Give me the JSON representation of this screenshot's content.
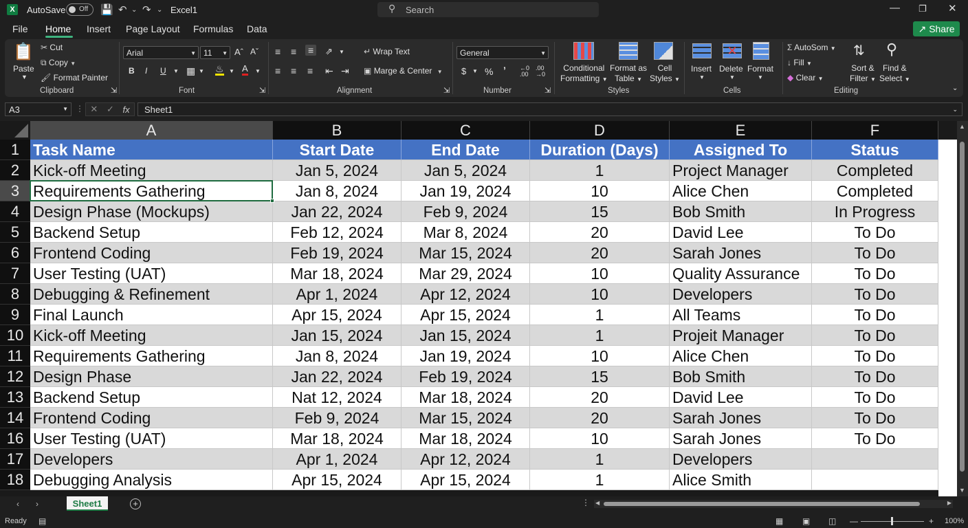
{
  "titlebar": {
    "autosave_label": "AutoSave",
    "autosave_state": "Off",
    "doc_title": "Excel1",
    "search_placeholder": "Search"
  },
  "menu": {
    "tabs": [
      "File",
      "Home",
      "Insert",
      "Page Layout",
      "Formulas",
      "Data"
    ],
    "share_label": "Share"
  },
  "ribbon": {
    "clipboard": {
      "paste": "Paste",
      "cut": "Cut",
      "copy": "Copy",
      "format_painter": "Format Painter",
      "label": "Clipboard"
    },
    "font": {
      "name": "Arial",
      "size": "11",
      "label": "Font"
    },
    "alignment": {
      "wrap_text": "Wrap Text",
      "merge_center": "Marge & Center",
      "label": "Alignment"
    },
    "number": {
      "format": "General",
      "label": "Number"
    },
    "styles": {
      "conditional_1": "Conditional",
      "conditional_2": "Formatting",
      "format_table_1": "Format as",
      "format_table_2": "Table",
      "cell_styles_1": "Cell",
      "cell_styles_2": "Styles",
      "label": "Styles"
    },
    "cells": {
      "insert": "Insert",
      "delete": "Delete",
      "format": "Format",
      "label": "Cells"
    },
    "editing": {
      "autosum": "AutoSom",
      "fill": "Fill",
      "clear": "Clear",
      "sort_1": "Sort &",
      "sort_2": "Filter",
      "find_1": "Find &",
      "find_2": "Select",
      "label": "Editing"
    }
  },
  "formula_bar": {
    "name_box": "A3",
    "formula": "Sheet1"
  },
  "sheet": {
    "columns": [
      "A",
      "B",
      "C",
      "D",
      "E",
      "F"
    ],
    "selected_column": "A",
    "selected_row": "3",
    "header_row_num": "1",
    "headers": [
      "Task Name",
      "Start Date",
      "End Date",
      "Duration (Days)",
      "Assigned To",
      "Status"
    ],
    "rows": [
      {
        "num": "2",
        "cells": [
          "Kick-off Meeting",
          "Jan 5, 2024",
          "Jan 5, 2024",
          "1",
          "Project Manager",
          "Completed"
        ]
      },
      {
        "num": "3",
        "cells": [
          "Requirements Gathering",
          "Jan 8, 2024",
          "Jan 19, 2024",
          "10",
          "Alice Chen",
          "Completed"
        ]
      },
      {
        "num": "4",
        "cells": [
          "Design Phase (Mockups)",
          "Jan 22, 2024",
          "Feb 9, 2024",
          "15",
          "Bob Smith",
          "In Progress"
        ]
      },
      {
        "num": "5",
        "cells": [
          "Backend Setup",
          "Feb 12, 2024",
          "Mar 8, 2024",
          "20",
          "David Lee",
          "To Do"
        ]
      },
      {
        "num": "6",
        "cells": [
          "Frontend Coding",
          "Feb 19, 2024",
          "Mar 15, 2024",
          "20",
          "Sarah Jones",
          "To Do"
        ]
      },
      {
        "num": "7",
        "cells": [
          "User Testing (UAT)",
          "Mar 18, 2024",
          "Mar 29, 2024",
          "10",
          "Quality Assurance",
          "To Do"
        ]
      },
      {
        "num": "8",
        "cells": [
          "Debugging & Refinement",
          "Apr 1, 2024",
          "Apr 12, 2024",
          "10",
          "Developers",
          "To Do"
        ]
      },
      {
        "num": "9",
        "cells": [
          "Final Launch",
          "Apr 15, 2024",
          "Apr 15, 2024",
          "1",
          "All Teams",
          "To Do"
        ]
      },
      {
        "num": "10",
        "cells": [
          "Kick-off Meeting",
          "Jan 15, 2024",
          "Jan 15, 2024",
          "1",
          "Projeit Manager",
          "To Do"
        ]
      },
      {
        "num": "11",
        "cells": [
          "Requirements Gathering",
          "Jan 8, 2024",
          "Jan 19, 2024",
          "10",
          "Alice Chen",
          "To Do"
        ]
      },
      {
        "num": "12",
        "cells": [
          "Design Phase",
          "Jan 22, 2024",
          "Feb 19, 2024",
          "15",
          "Bob Smith",
          "To Do"
        ]
      },
      {
        "num": "13",
        "cells": [
          "Backend Setup",
          "Nat 12, 2024",
          "Mar 18, 2024",
          "20",
          "David Lee",
          "To Do"
        ]
      },
      {
        "num": "14",
        "cells": [
          "Frontend Coding",
          "Feb 9, 2024",
          "Mar 15, 2024",
          "20",
          "Sarah Jones",
          "To Do"
        ]
      },
      {
        "num": "16",
        "cells": [
          "User Testing (UAT)",
          "Mar 18, 2024",
          "Mar 18, 2024",
          "10",
          "Sarah Jones",
          "To Do"
        ]
      },
      {
        "num": "17",
        "cells": [
          "Developers",
          "Apr   1, 2024",
          "Apr 12, 2024",
          "1",
          "Developers",
          ""
        ]
      },
      {
        "num": "18",
        "cells": [
          "Debugging Analysis",
          "Apr 15, 2024",
          "Apr 15, 2024",
          "1",
          "Alice  Smith",
          ""
        ]
      }
    ]
  },
  "sheet_tabs": {
    "active": "Sheet1"
  },
  "status": {
    "ready": "Ready",
    "zoom": "100%"
  },
  "colors": {
    "header_fill": "#4472c4",
    "band_gray": "#d9d9d9",
    "excel_green": "#107c41",
    "share_green": "#1e8a4c"
  }
}
